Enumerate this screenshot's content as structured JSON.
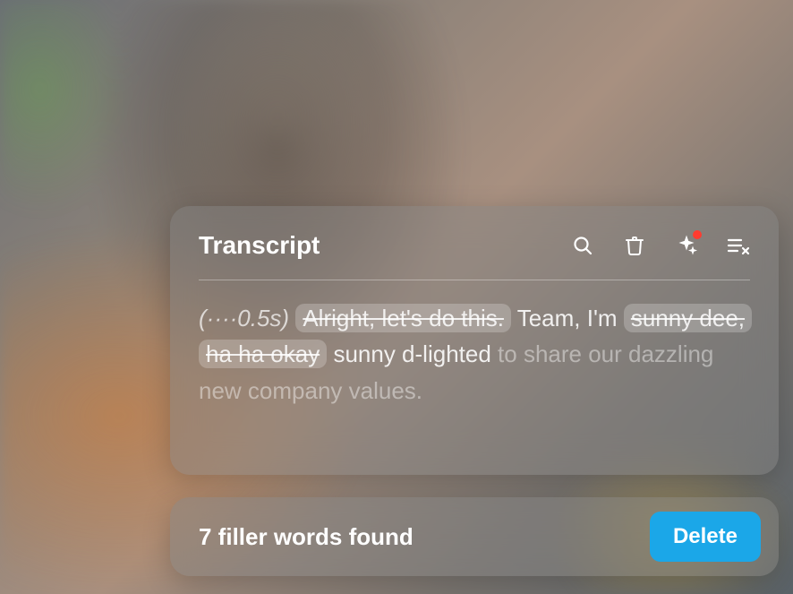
{
  "transcript": {
    "title": "Transcript",
    "pause_marker": "(····0.5s)",
    "removed_1": "Alright, let's do this.",
    "kept_1": "Team, I'm",
    "removed_2": "sunny dee, ha ha okay",
    "kept_2": "sunny d-lighted",
    "faded_tail": "to share our dazzling new company values."
  },
  "filler": {
    "message": "7 filler words found",
    "action_label": "Delete"
  }
}
